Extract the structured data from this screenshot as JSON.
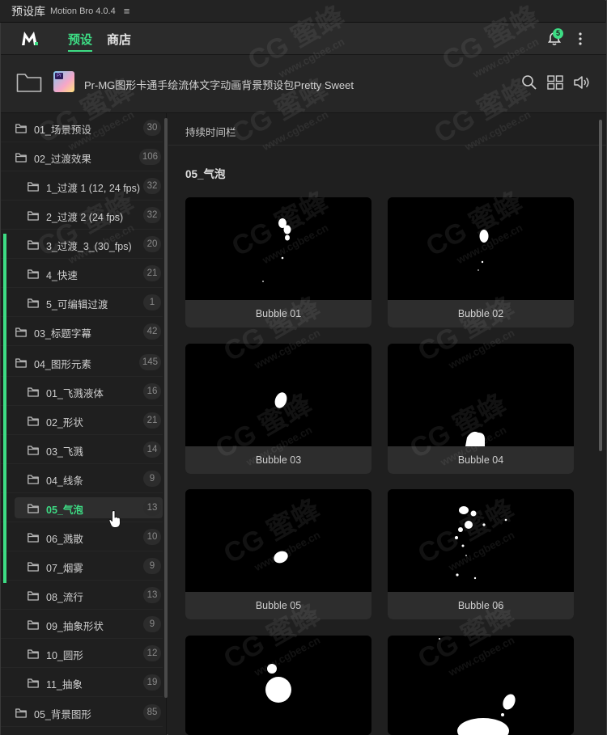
{
  "panel": {
    "title": "预设库",
    "version": "Motion Bro 4.0.4",
    "menu_glyph": "≡"
  },
  "header": {
    "tabs": [
      {
        "label": "预设",
        "active": true
      },
      {
        "label": "商店",
        "active": false
      }
    ],
    "notification_count": "5",
    "accent": "#3ddc84"
  },
  "pack": {
    "title": "Pr-MG图形卡通手绘流体文字动画背景预设包Pretty Sweet",
    "thumb_text": "Pr"
  },
  "sidebar": {
    "items": [
      {
        "label": "01_场景预设",
        "count": "30"
      },
      {
        "label": "02_过渡效果",
        "count": "106"
      },
      {
        "label": "1_过渡 1 (12, 24 fps)",
        "count": "32"
      },
      {
        "label": "2_过渡 2 (24 fps)",
        "count": "32"
      },
      {
        "label": "3_过渡_3_(30_fps)",
        "count": "20"
      },
      {
        "label": "4_快速",
        "count": "21"
      },
      {
        "label": "5_可编辑过渡",
        "count": "1"
      },
      {
        "label": "03_标题字幕",
        "count": "42"
      },
      {
        "label": "04_图形元素",
        "count": "145"
      },
      {
        "label": "01_飞溅液体",
        "count": "16"
      },
      {
        "label": "02_形状",
        "count": "21"
      },
      {
        "label": "03_飞溅",
        "count": "14"
      },
      {
        "label": "04_线条",
        "count": "9"
      },
      {
        "label": "05_气泡",
        "count": "13"
      },
      {
        "label": "06_溅散",
        "count": "10"
      },
      {
        "label": "07_烟雾",
        "count": "9"
      },
      {
        "label": "08_流行",
        "count": "13"
      },
      {
        "label": "09_抽象形状",
        "count": "9"
      },
      {
        "label": "10_圆形",
        "count": "12"
      },
      {
        "label": "11_抽象",
        "count": "19"
      },
      {
        "label": "05_背景图形",
        "count": "85"
      }
    ]
  },
  "main": {
    "duration_label": "持续时间栏",
    "section_title": "05_气泡",
    "cards": [
      {
        "name": "Bubble 01"
      },
      {
        "name": "Bubble 02"
      },
      {
        "name": "Bubble 03"
      },
      {
        "name": "Bubble 04"
      },
      {
        "name": "Bubble 05"
      },
      {
        "name": "Bubble 06"
      },
      {
        "name": ""
      },
      {
        "name": ""
      }
    ]
  },
  "watermark": {
    "text": "CG 蜜蜂",
    "url": "www.cgbee.cn"
  }
}
